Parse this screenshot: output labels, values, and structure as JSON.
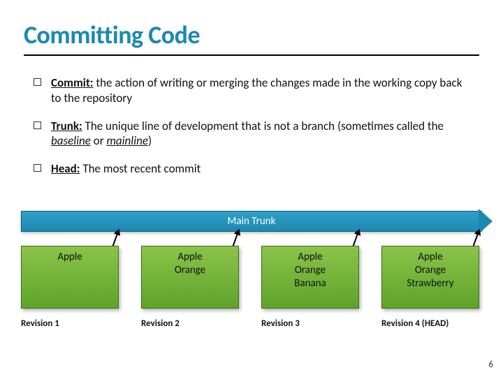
{
  "title": "Committing Code",
  "bullets": [
    {
      "term": "Commit:",
      "text": " the action of writing or merging the changes made in the working copy back to the repository"
    },
    {
      "term": "Trunk:",
      "text_pre": " The unique line of development that is not a branch (sometimes called the ",
      "em1": "baseline",
      "mid": " or ",
      "em2": "mainline",
      "text_post": ")"
    },
    {
      "term": "Head:",
      "text": " The most recent commit"
    }
  ],
  "trunk_label": "Main Trunk",
  "revisions": [
    {
      "lines": [
        "Apple"
      ],
      "label": "Revision 1"
    },
    {
      "lines": [
        "Apple",
        "Orange"
      ],
      "label": "Revision 2"
    },
    {
      "lines": [
        "Apple",
        "Orange",
        "Banana"
      ],
      "label": "Revision 3"
    },
    {
      "lines": [
        "Apple",
        "Orange",
        "Strawberry"
      ],
      "label": "Revision 4 (HEAD)"
    }
  ],
  "page_number": "6"
}
